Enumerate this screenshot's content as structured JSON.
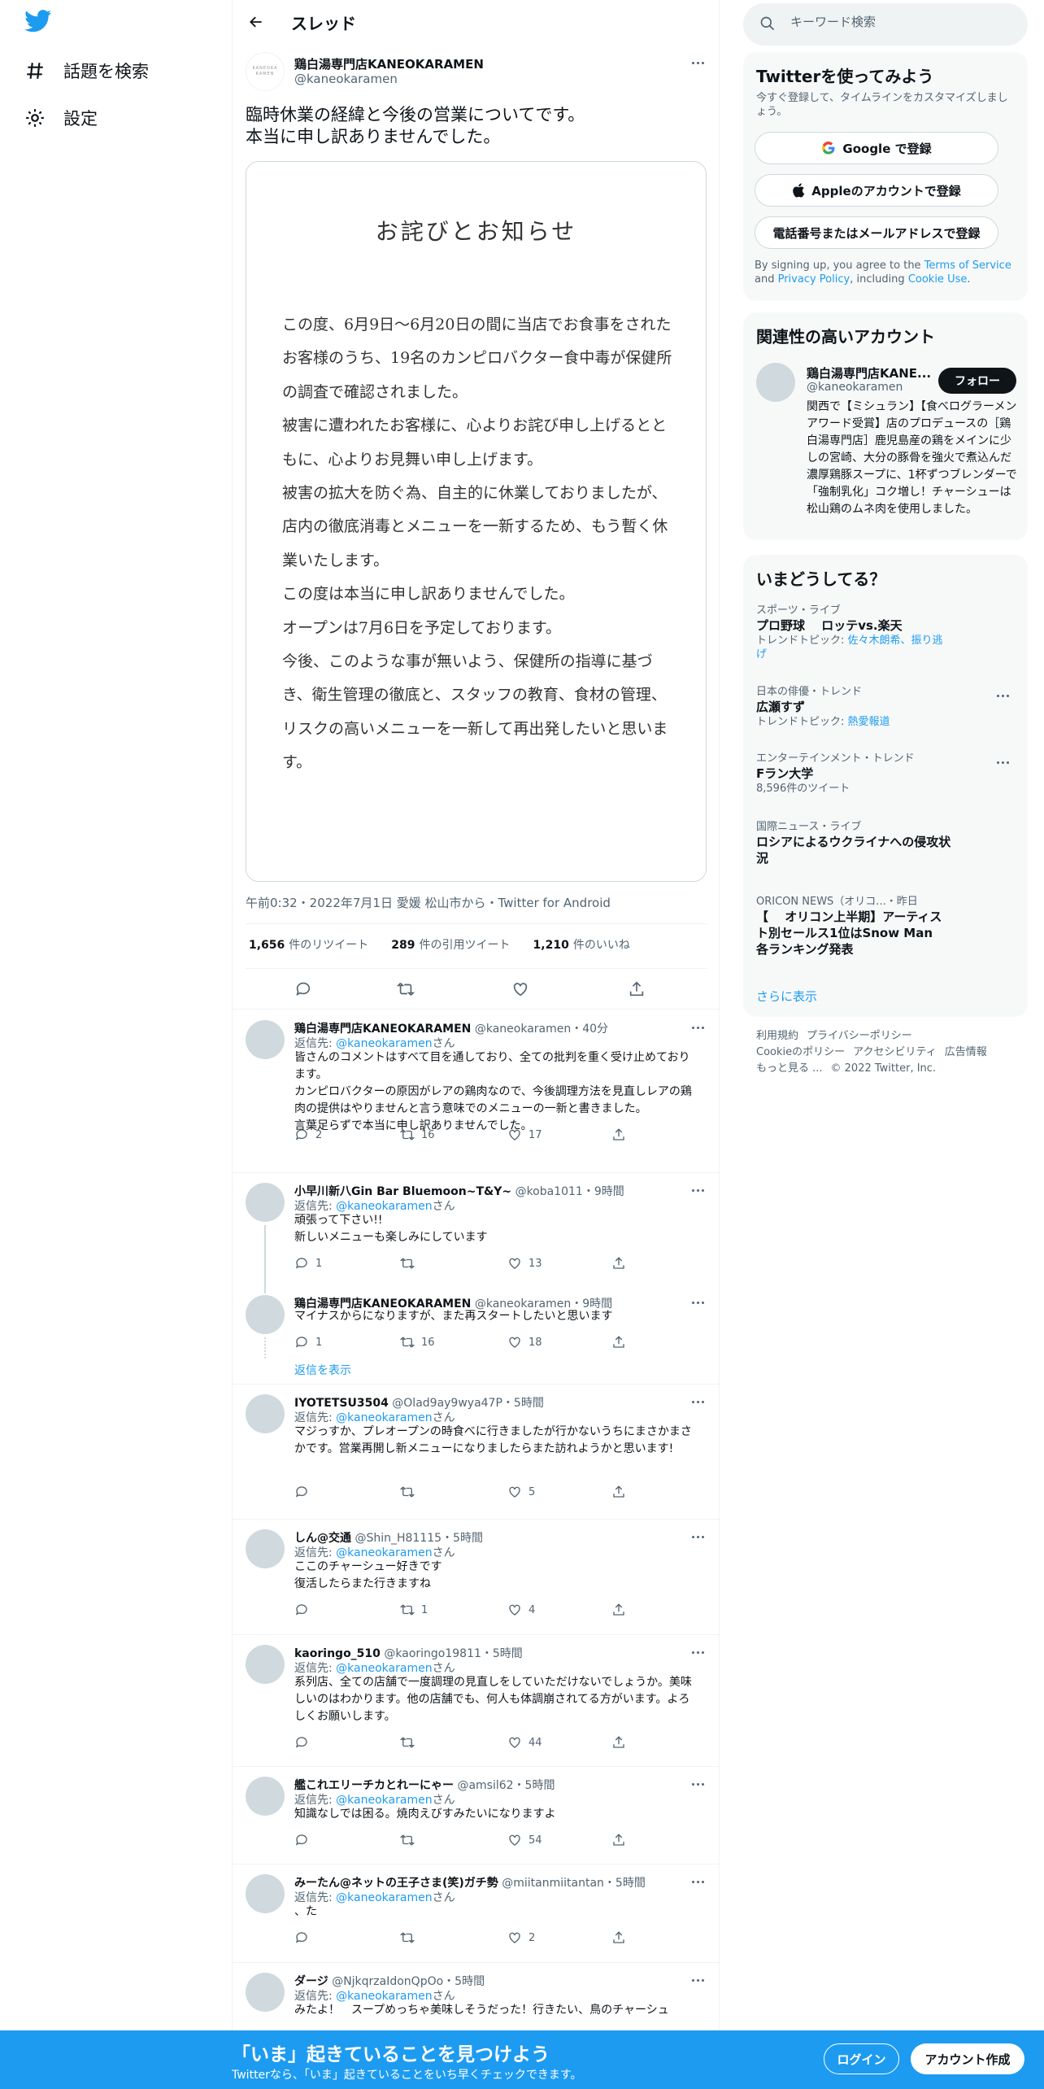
{
  "nav": {
    "items": [
      {
        "label": "話題を検索",
        "icon": "hashtag-icon"
      },
      {
        "label": "設定",
        "icon": "gear-icon"
      }
    ]
  },
  "header": {
    "title": "スレッド"
  },
  "tweet": {
    "display_name": "鶏白湯専門店KANEOKARAMEN",
    "handle": "@kaneokaramen",
    "text": "臨時休業の経緯と今後の営業についてです。\n本当に申し訳ありませんでした。",
    "image": {
      "title": "お詫びとお知らせ",
      "paragraphs": [
        "この度、6月9日〜6月20日の間に当店でお食事をされたお客様のうち、19名のカンピロバクター食中毒が保健所の調査で確認されました。",
        "被害に遭われたお客様に、心よりお詫び申し上げるとともに、心よりお見舞い申し上げます。",
        "被害の拡大を防ぐ為、自主的に休業しておりましたが、店内の徹底消毒とメニューを一新するため、もう暫く休業いたします。",
        "この度は本当に申し訳ありませんでした。",
        "オープンは7月6日を予定しております。",
        "今後、このような事が無いよう、保健所の指導に基づき、衛生管理の徹底と、スタッフの教育、食材の管理、リスクの高いメニューを一新して再出発したいと思います。"
      ]
    },
    "meta": "午前0:32・2022年7月1日  愛媛 松山市から・Twitter for Android",
    "stats": {
      "retweets": "1,656",
      "retweets_label": "件のリツイート",
      "quotes": "289",
      "quotes_label": "件の引用ツイート",
      "likes": "1,210",
      "likes_label": "件のいいね"
    }
  },
  "replies": [
    {
      "name": "鶏白湯専門店KANEOKARAMEN",
      "meta": "@kaneokaramen・40分",
      "reply_to_prefix": "返信先: ",
      "reply_to": "@kaneokaramen",
      "reply_to_suffix": "さん",
      "text": "皆さんのコメントはすべて目を通しており、全ての批判を重く受け止めております。\nカンピロバクターの原因がレアの鶏肉なので、今後調理方法を見直しレアの鶏肉の提供はやりませんと言う意味でのメニューの一新と書きました。\n言葉足らずで本当に申し訳ありませんでした。",
      "replies": "2",
      "retweets": "16",
      "likes": "17"
    },
    {
      "name": "小早川新八Gin Bar Bluemoon~T&Y~",
      "meta": "@koba1011・9時間",
      "reply_to_prefix": "返信先: ",
      "reply_to": "@kaneokaramen",
      "reply_to_suffix": "さん",
      "text": "頑張って下さい!!\n新しいメニューも楽しみにしています",
      "replies": "1",
      "retweets": "",
      "likes": "13"
    },
    {
      "name": "鶏白湯専門店KANEOKARAMEN",
      "meta": "@kaneokaramen・9時間",
      "text": "マイナスからになりますが、また再スタートしたいと思います",
      "replies": "1",
      "retweets": "16",
      "likes": "18",
      "show_replies": "返信を表示"
    },
    {
      "name": "IYOTETSU3504",
      "meta": "@Olad9ay9wya47P・5時間",
      "reply_to_prefix": "返信先: ",
      "reply_to": "@kaneokaramen",
      "reply_to_suffix": "さん",
      "text": "マジっすか、プレオープンの時食べに行きましたが行かないうちにまさかまさかです。営業再開し新メニューになりましたらまた訪れようかと思います!",
      "replies": "",
      "retweets": "",
      "likes": "5"
    },
    {
      "name": "しん@交通",
      "meta": "@Shin_H81115・5時間",
      "reply_to_prefix": "返信先: ",
      "reply_to": "@kaneokaramen",
      "reply_to_suffix": "さん",
      "text": "ここのチャーシュー好きです\n復活したらまた行きますね",
      "replies": "",
      "retweets": "1",
      "likes": "4"
    },
    {
      "name": "kaoringo_510",
      "meta": "@kaoringo19811・5時間",
      "reply_to_prefix": "返信先: ",
      "reply_to": "@kaneokaramen",
      "reply_to_suffix": "さん",
      "text": "系列店、全ての店舗で一度調理の見直しをしていただけないでしょうか。美味しいのはわかります。他の店舗でも、何人も体調崩されてる方がいます。よろしくお願いします。",
      "replies": "",
      "retweets": "",
      "likes": "44"
    },
    {
      "name": "艦これエリーチカとれーにゃー",
      "meta": "@amsil62・5時間",
      "reply_to_prefix": "返信先: ",
      "reply_to": "@kaneokaramen",
      "reply_to_suffix": "さん",
      "text": "知識なしでは困る。焼肉えびすみたいになりますよ",
      "replies": "",
      "retweets": "",
      "likes": "54"
    },
    {
      "name": "みーたん@ネットの王子さま(笑)ガチ勢",
      "meta": "@miitanmiitantan・5時間",
      "reply_to_prefix": "返信先: ",
      "reply_to": "@kaneokaramen",
      "reply_to_suffix": "さん",
      "text": "、た",
      "replies": "",
      "retweets": "",
      "likes": "2"
    },
    {
      "name": "ダージ",
      "meta": "@NjkqrzaIdonQpOo・5時間",
      "reply_to_prefix": "返信先: ",
      "reply_to": "@kaneokaramen",
      "reply_to_suffix": "さん",
      "text": "みたよ！　スープめっちゃ美味しそうだった！行きたい、鳥のチャーシュ",
      "replies": "",
      "retweets": "",
      "likes": ""
    }
  ],
  "search": {
    "placeholder": "キーワード検索"
  },
  "signup": {
    "title": "Twitterを使ってみよう",
    "subtitle": "今すぐ登録して、タイムラインをカスタマイズしましょう。",
    "google": "Google で登録",
    "apple": "Appleのアカウントで登録",
    "phone": "電話番号またはメールアドレスで登録",
    "terms_a": "By signing up, you agree to the ",
    "terms_link1": "Terms of Service",
    "terms_b": " and ",
    "terms_link2": "Privacy Policy",
    "terms_c": ", including ",
    "terms_link3": "Cookie Use",
    "terms_d": "."
  },
  "related": {
    "title": "関連性の高いアカウント",
    "name": "鶏白湯専門店KANE...",
    "handle": "@kaneokaramen",
    "follow": "フォロー",
    "bio": "関西で【ミシュラン】【食べログラーメンアワード受賞】店のプロデュースの［鶏白湯専門店］鹿児島産の鶏をメインに少しの宮崎、大分の豚骨を強火で煮込んだ濃厚鶏豚スープに、1杯ずつブレンダーで「強制乳化」コク増し！チャーシューは松山鶏のムネ肉を使用しました。"
  },
  "trends": {
    "title": "いまどうしてる？",
    "items": [
      {
        "category": "スポーツ・ライブ",
        "name": "プロ野球　 ロッテvs.楽天",
        "sub_prefix": "トレンドトピック: ",
        "sub_link": "佐々木朗希、振り逃げ"
      },
      {
        "category": "日本の俳優・トレンド",
        "name": "広瀬すず",
        "sub_prefix": "トレンドトピック: ",
        "sub_link": "熱愛報道"
      },
      {
        "category": "エンターテインメント・トレンド",
        "name": "Fラン大学",
        "sub_prefix": "8,596件のツイート",
        "sub_link": ""
      },
      {
        "category": "国際ニュース・ライブ",
        "name": "ロシアによるウクライナへの侵攻状況",
        "sub_prefix": "",
        "sub_link": ""
      },
      {
        "category": "ORICON NEWS（オリコ...・昨日",
        "name": "【　 オリコン上半期】アーティスト別セールス1位はSnow Man　 各ランキング発表",
        "sub_prefix": "",
        "sub_link": ""
      }
    ],
    "show_more": "さらに表示"
  },
  "footer": {
    "links": [
      "利用規約",
      "プライバシーポリシー",
      "Cookieのポリシー",
      "アクセシビリティ",
      "広告情報",
      "もっと見る ...",
      "© 2022 Twitter, Inc."
    ]
  },
  "bottom": {
    "title": "「いま」起きていることを見つけよう",
    "subtitle": "Twitterなら、「いま」起きていることをいち早くチェックできます。",
    "login": "ログイン",
    "signup": "アカウント作成"
  },
  "colors": {
    "accent": "#1d9bf0",
    "text": "#0f1419",
    "muted": "#536471"
  }
}
